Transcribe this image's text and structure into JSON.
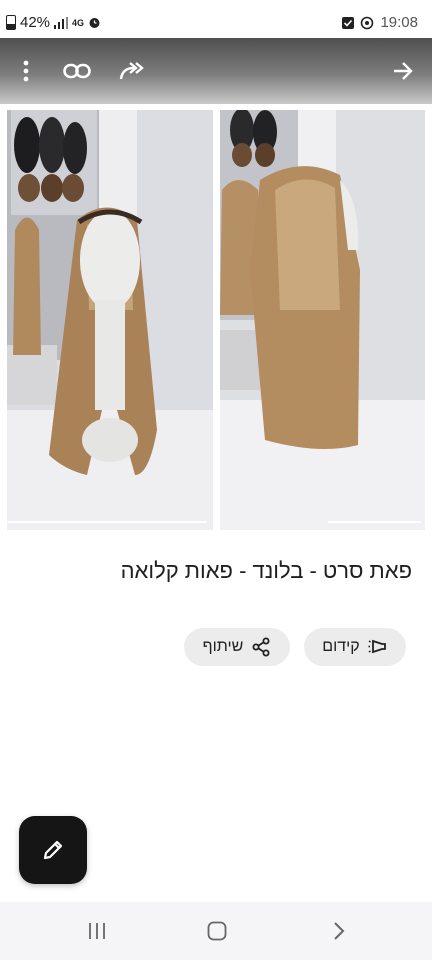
{
  "status_bar": {
    "battery_percent": "42%",
    "network_label": "4G",
    "time": "19:08"
  },
  "toolbar": {
    "icons": [
      "more-vert-icon",
      "link-icon",
      "forward-all-icon",
      "arrow-forward-icon"
    ]
  },
  "gallery": {
    "photo_count": 2,
    "current_index": 1
  },
  "listing": {
    "title": "פאת סרט - בלונד - פאות קלואה"
  },
  "actions": {
    "promote_label": "קידום",
    "share_label": "שיתוף"
  },
  "colors": {
    "topbar_dark": "#4f4f4f",
    "pill_bg": "#ececec",
    "fab_bg": "#151515",
    "navbar_bg": "#f5f5f7"
  }
}
